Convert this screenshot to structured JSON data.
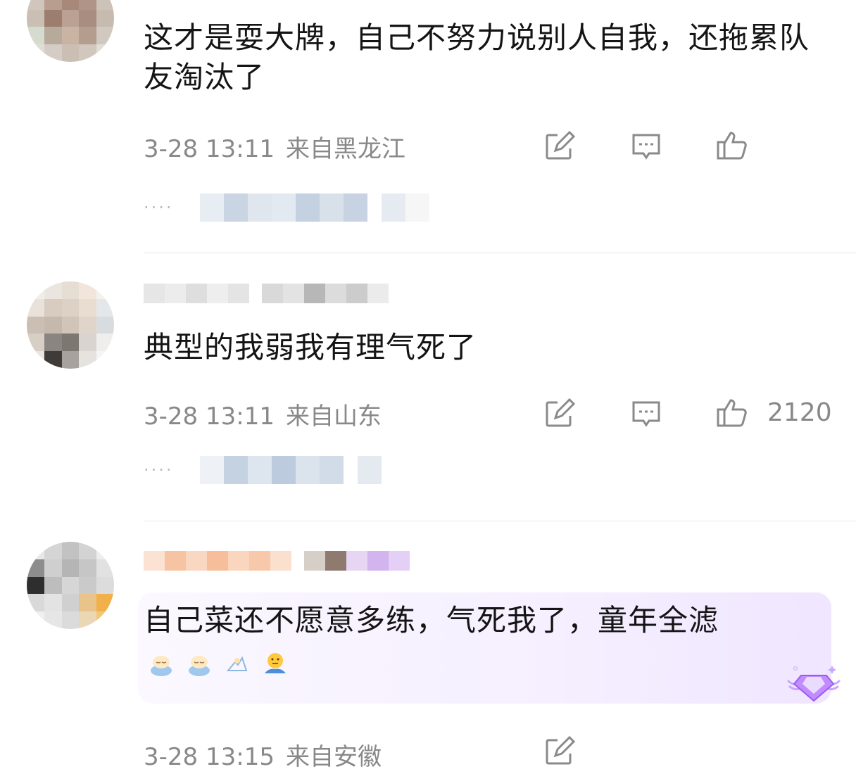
{
  "comments": [
    {
      "text": "这才是耍大牌，自己不努力说别人自我，还拖累队友淘汰了",
      "time": "3-28 13:11",
      "location": "来自黑龙江",
      "likes": ""
    },
    {
      "text": "典型的我弱我有理气死了",
      "time": "3-28 13:11",
      "location": "来自山东",
      "likes": "2120"
    },
    {
      "text": "自己菜还不愿意多练，气死我了，童年全滤",
      "time": "3-28 13:15",
      "location": "来自安徽",
      "likes": ""
    }
  ],
  "reply_ellipsis": "····",
  "icons": {
    "edit": "edit-icon",
    "comment": "comment-icon",
    "like": "thumbs-up-icon",
    "gem": "gem-badge-icon"
  },
  "colors": {
    "text": "#141414",
    "meta": "#888888",
    "icon": "#8a8a8a",
    "highlight": "#f3ecff",
    "gem": "#b57cff"
  }
}
